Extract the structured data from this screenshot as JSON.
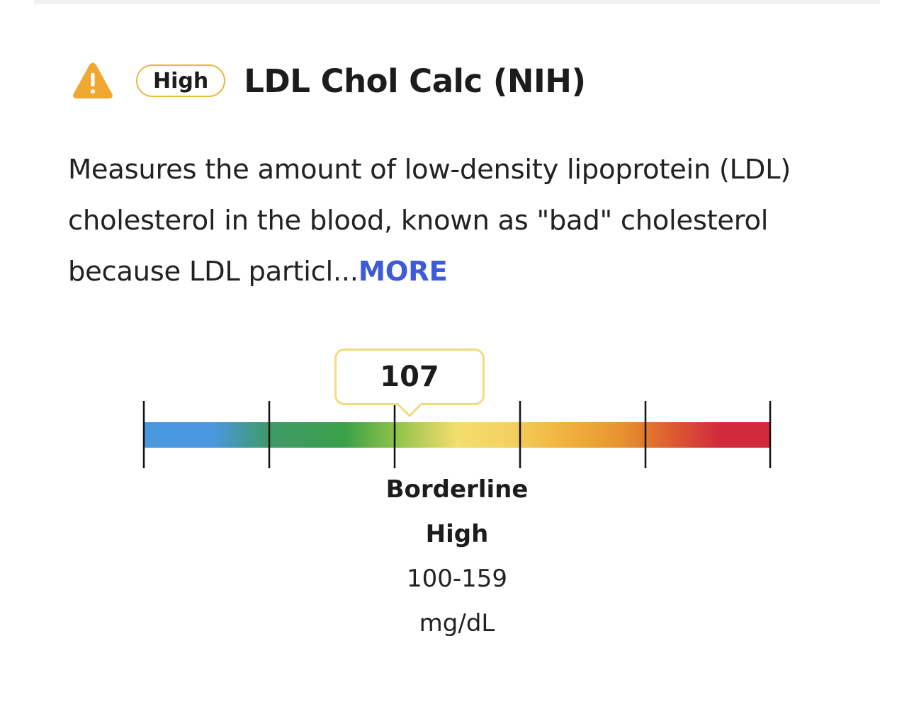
{
  "header": {
    "icon": "warning-triangle-icon",
    "badge": "High",
    "title": "LDL Chol Calc (NIH)"
  },
  "description": {
    "text": "Measures the amount of low-density lipoprotein (LDL) cholesterol in the blood, known as \"bad\" cholesterol because LDL particl...",
    "more_label": "MORE"
  },
  "gauge": {
    "value": "107",
    "range_name_line1": "Borderline",
    "range_name_line2": "High",
    "range_values": "100-159",
    "range_unit": "mg/dL",
    "colors": [
      "#4a98e0",
      "#3aa04a",
      "#f4de6c",
      "#f1b640",
      "#e07a2e",
      "#d12a3c"
    ]
  },
  "colors": {
    "warning": "#f1a832",
    "badge_border": "#e8b840",
    "link": "#3d5bd9",
    "callout_border": "#f1dc7c"
  }
}
